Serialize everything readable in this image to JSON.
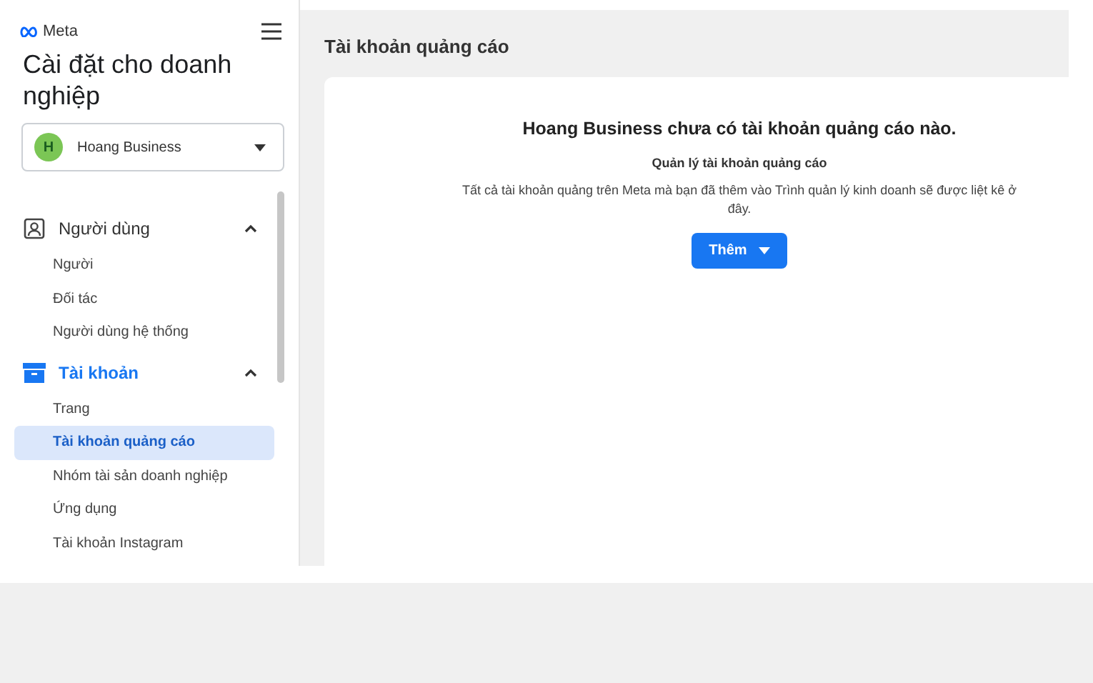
{
  "sidebar": {
    "brand": "Meta",
    "title": "Cài đặt cho doanh nghiệp",
    "business": {
      "initial": "H",
      "name": "Hoang Business"
    },
    "sections": [
      {
        "kind": "users",
        "label": "Người dùng",
        "expanded": true,
        "selected": false,
        "items": [
          {
            "label": "Người",
            "selected": false
          },
          {
            "label": "Đối tác",
            "selected": false
          },
          {
            "label": "Người dùng hệ thống",
            "selected": false
          }
        ]
      },
      {
        "kind": "accounts",
        "label": "Tài khoản",
        "expanded": true,
        "selected": true,
        "items": [
          {
            "label": "Trang",
            "selected": false
          },
          {
            "label": "Tài khoản quảng cáo",
            "selected": true
          },
          {
            "label": "Nhóm tài sản doanh nghiệp",
            "selected": false
          },
          {
            "label": "Ứng dụng",
            "selected": false
          },
          {
            "label": "Tài khoản Instagram",
            "selected": false
          }
        ]
      }
    ]
  },
  "main": {
    "title": "Tài khoản quảng cáo",
    "empty_state": {
      "heading": "Hoang Business chưa có tài khoản quảng cáo nào.",
      "subheading": "Quản lý tài khoản quảng cáo",
      "description": "Tất cả tài khoản quảng trên Meta mà bạn đã thêm vào Trình quản lý kinh doanh sẽ được liệt kê ở đây.",
      "button": "Thêm"
    }
  }
}
